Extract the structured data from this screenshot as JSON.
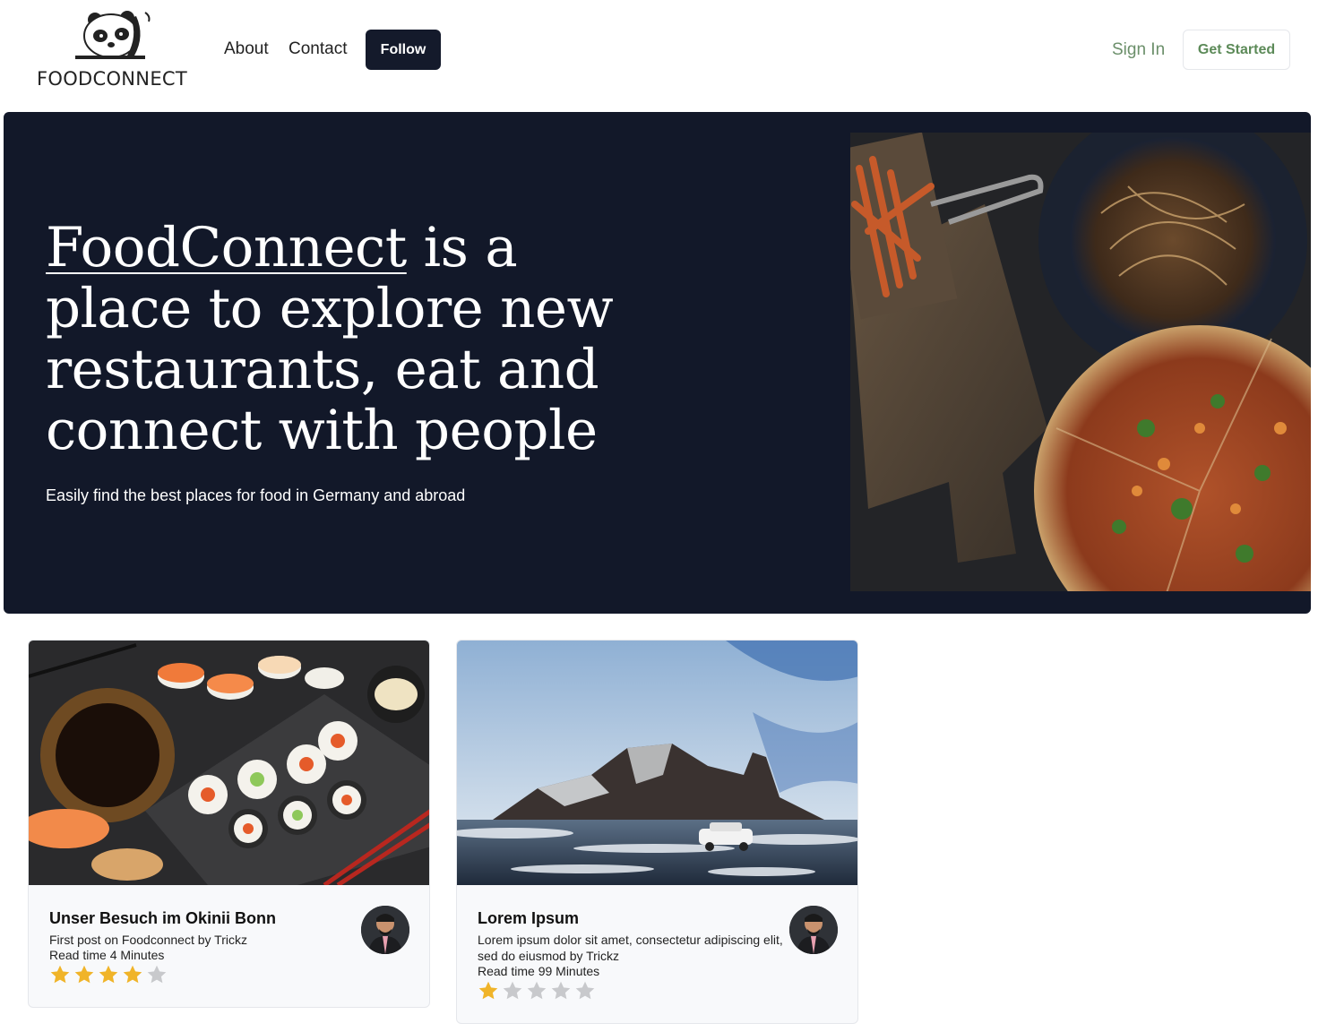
{
  "header": {
    "logo_text": "FOODCONNECT",
    "nav": {
      "about": "About",
      "contact": "Contact"
    },
    "follow_label": "Follow",
    "signin_label": "Sign In",
    "get_started_label": "Get Started"
  },
  "hero": {
    "title_brand": "FoodConnect",
    "title_rest": " is a place to explore new restaurants, eat and connect with people",
    "subtitle": "Easily find the best places for food in Germany and abroad"
  },
  "cards": [
    {
      "title": "Unser Besuch im Okinii Bonn",
      "desc": "First post on Foodconnect by Trickz",
      "read_time": "Read time 4 Minutes",
      "rating": 4,
      "max_rating": 5
    },
    {
      "title": "Lorem Ipsum",
      "desc": "Lorem ipsum dolor sit amet, consectetur adipiscing elit, sed do eiusmod by Trickz",
      "read_time": "Read time 99 Minutes",
      "rating": 1,
      "max_rating": 5
    }
  ],
  "colors": {
    "hero_bg": "#121829",
    "follow_bg": "#141a2b",
    "accent_green": "#5c8a58",
    "star_filled": "#f0b429",
    "star_empty": "#c8c9cc"
  }
}
